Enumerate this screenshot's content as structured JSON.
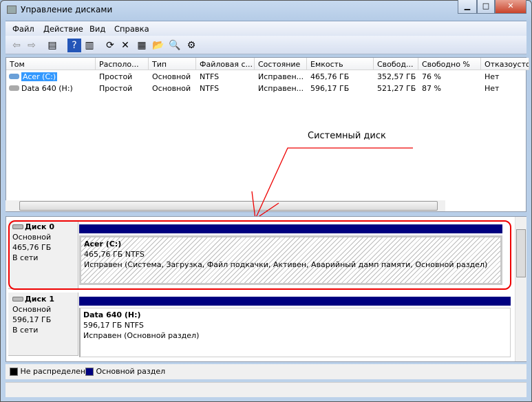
{
  "window": {
    "title": "Управление дисками",
    "minimize": "▁",
    "maximize": "□",
    "close": "✕"
  },
  "menu": [
    "Файл",
    "Действие",
    "Вид",
    "Справка"
  ],
  "toolbar": [
    {
      "name": "back-icon",
      "glyph": "⇦"
    },
    {
      "name": "forward-icon",
      "glyph": "⇨"
    },
    {
      "name": "console-tree-icon",
      "glyph": "▤"
    },
    {
      "name": "help-icon",
      "glyph": "?"
    },
    {
      "name": "action-pane-icon",
      "glyph": "▥"
    },
    {
      "name": "refresh-icon",
      "glyph": "⟳"
    },
    {
      "name": "delete-icon",
      "glyph": "✕"
    },
    {
      "name": "properties-icon",
      "glyph": "▦"
    },
    {
      "name": "open-icon",
      "glyph": "📂"
    },
    {
      "name": "explore-icon",
      "glyph": "🔍"
    },
    {
      "name": "settings-icon",
      "glyph": "⚙"
    }
  ],
  "columns": [
    "Том",
    "Располо...",
    "Тип",
    "Файловая с...",
    "Состояние",
    "Емкость",
    "Свобод...",
    "Свободно %",
    "Отказоустойч"
  ],
  "rows": [
    [
      "Acer (C:)",
      "Простой",
      "Основной",
      "NTFS",
      "Исправен...",
      "465,76 ГБ",
      "352,57 ГБ",
      "76 %",
      "Нет"
    ],
    [
      "Data 640 (H:)",
      "Простой",
      "Основной",
      "NTFS",
      "Исправен...",
      "596,17 ГБ",
      "521,27 ГБ",
      "87 %",
      "Нет"
    ]
  ],
  "annotation": "Системный диск",
  "disks": [
    {
      "name": "Диск 0",
      "type": "Основной",
      "size": "465,76 ГБ",
      "status": "В сети",
      "part_name": "Acer  (C:)",
      "part_size": "465,76 ГБ NTFS",
      "part_status": "Исправен (Система, Загрузка, Файл подкачки, Активен, Аварийный дамп памяти, Основной раздел)"
    },
    {
      "name": "Диск 1",
      "type": "Основной",
      "size": "596,17 ГБ",
      "status": "В сети",
      "part_name": "Data 640  (H:)",
      "part_size": "596,17 ГБ NTFS",
      "part_status": "Исправен (Основной раздел)"
    }
  ],
  "legend": [
    {
      "label": "Не распределен",
      "color": "#000000"
    },
    {
      "label": "Основной раздел",
      "color": "#000080"
    }
  ]
}
